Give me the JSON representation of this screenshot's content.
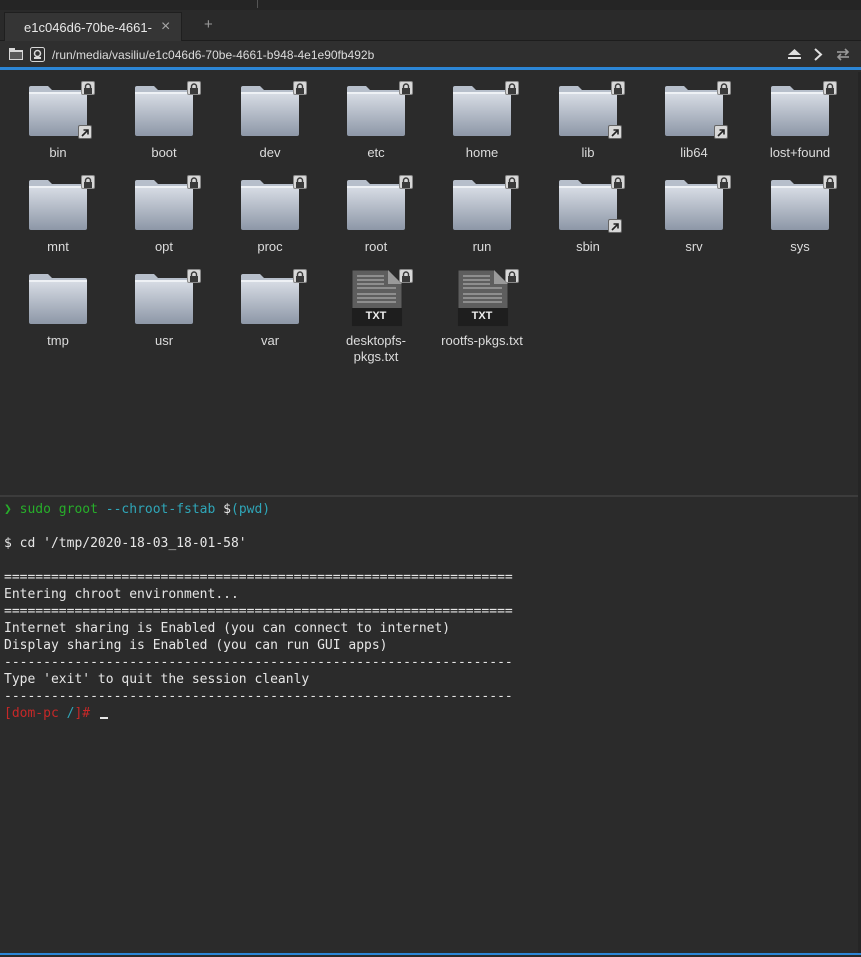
{
  "tab": {
    "title": "e1c046d6-70be-4661-",
    "close_glyph": "×",
    "new_tab_glyph": "+"
  },
  "address": {
    "path": "/run/media/vasiliu/e1c046d6-70be-4661-b948-4e1e90fb492b",
    "icons": [
      "folder-icon",
      "location-icon",
      "eject-icon",
      "forward-icon",
      "swap-icon"
    ]
  },
  "files": [
    {
      "name": "bin",
      "type": "folder",
      "locked": true,
      "symlink": true
    },
    {
      "name": "boot",
      "type": "folder",
      "locked": true,
      "symlink": false
    },
    {
      "name": "dev",
      "type": "folder",
      "locked": true,
      "symlink": false
    },
    {
      "name": "etc",
      "type": "folder",
      "locked": true,
      "symlink": false
    },
    {
      "name": "home",
      "type": "folder",
      "locked": true,
      "symlink": false
    },
    {
      "name": "lib",
      "type": "folder",
      "locked": true,
      "symlink": true
    },
    {
      "name": "lib64",
      "type": "folder",
      "locked": true,
      "symlink": true
    },
    {
      "name": "lost+found",
      "type": "folder",
      "locked": true,
      "symlink": false
    },
    {
      "name": "mnt",
      "type": "folder",
      "locked": true,
      "symlink": false
    },
    {
      "name": "opt",
      "type": "folder",
      "locked": true,
      "symlink": false
    },
    {
      "name": "proc",
      "type": "folder",
      "locked": true,
      "symlink": false
    },
    {
      "name": "root",
      "type": "folder",
      "locked": true,
      "symlink": false
    },
    {
      "name": "run",
      "type": "folder",
      "locked": true,
      "symlink": false
    },
    {
      "name": "sbin",
      "type": "folder",
      "locked": true,
      "symlink": true
    },
    {
      "name": "srv",
      "type": "folder",
      "locked": true,
      "symlink": false
    },
    {
      "name": "sys",
      "type": "folder",
      "locked": true,
      "symlink": false
    },
    {
      "name": "tmp",
      "type": "folder",
      "locked": false,
      "symlink": false
    },
    {
      "name": "usr",
      "type": "folder",
      "locked": true,
      "symlink": false
    },
    {
      "name": "var",
      "type": "folder",
      "locked": true,
      "symlink": false
    },
    {
      "name": "desktopfs-pkgs.txt",
      "name_lines": [
        "desktopfs-",
        "pkgs.txt"
      ],
      "type": "txt",
      "badge": "TXT",
      "locked": true,
      "symlink": false
    },
    {
      "name": "rootfs-pkgs.txt",
      "type": "txt",
      "badge": "TXT",
      "locked": true,
      "symlink": false
    }
  ],
  "terminal": {
    "prompt_arrow": "❯",
    "cmd_sudo": "sudo groot",
    "cmd_flag": " --chroot-fstab ",
    "cmd_dollar": "$",
    "cmd_pwd": "(pwd)",
    "line_cd": "$ cd '/tmp/2020-18-03_18-01-58'",
    "rule_double": "=================================================================",
    "entering": "Entering chroot environment...",
    "internet": "Internet sharing is Enabled (you can connect to internet)",
    "display": "Display sharing is Enabled (you can run GUI apps)",
    "rule_single": "-----------------------------------------------------------------",
    "exit_hint": "Type 'exit' to quit the session cleanly",
    "root_prompt_host": "[dom-pc ",
    "root_prompt_dir": "/",
    "root_prompt_end": "]#"
  },
  "colors": {
    "accent": "#2c86d6",
    "prompt_green": "#27ae2a",
    "cmd_cyan": "#2fa6b8",
    "root_red": "#c62828",
    "folder_light": "#cfd5de",
    "folder_dark": "#8e98a8"
  }
}
